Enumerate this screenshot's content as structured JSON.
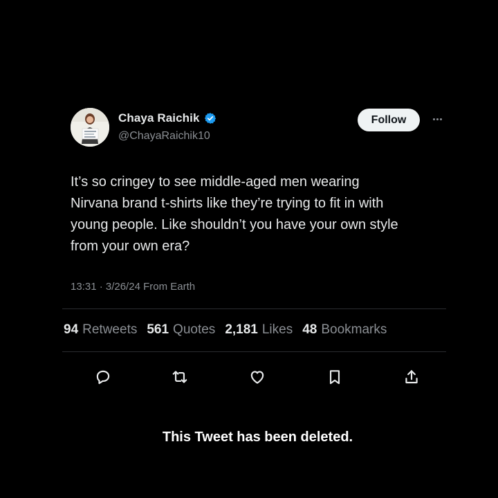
{
  "author": {
    "display_name": "Chaya Raichik",
    "handle": "@ChayaRaichik10",
    "verified_icon": "verified-badge-icon",
    "verified_color": "#1d9bf0"
  },
  "follow_label": "Follow",
  "tweet": {
    "lines": [
      "It’s so cringey to see middle-aged men wearing",
      "Nirvana brand t-shirts like they’re trying to fit in with",
      "young people. Like shouldn’t you have your own style",
      "from your own era?"
    ],
    "meta": "13:31 · 3/26/24 From Earth"
  },
  "stats": [
    {
      "count": "94",
      "label": "Retweets"
    },
    {
      "count": "561",
      "label": "Quotes"
    },
    {
      "count": "2,181",
      "label": "Likes"
    },
    {
      "count": "48",
      "label": "Bookmarks"
    }
  ],
  "actions": [
    "reply-icon",
    "retweet-icon",
    "like-icon",
    "bookmark-icon",
    "share-icon"
  ],
  "deleted_notice": "This Tweet has been deleted.",
  "colors": {
    "background": "#000000",
    "text": "#e7e9ea",
    "muted": "#8b8f94",
    "follow_button_bg": "#eff3f4"
  }
}
